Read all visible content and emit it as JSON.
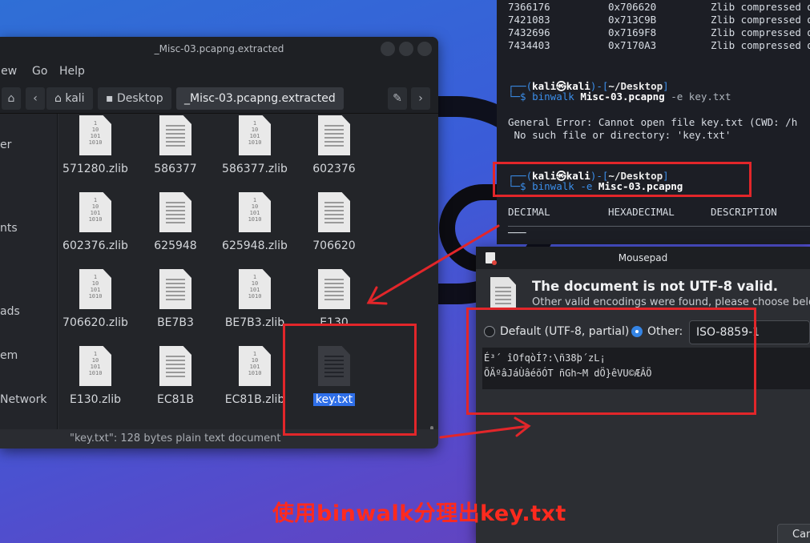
{
  "terminal": {
    "rows": [
      {
        "decimal": "7366176",
        "hex": "0x706620",
        "desc": "Zlib compressed data"
      },
      {
        "decimal": "7421083",
        "hex": "0x713C9B",
        "desc": "Zlib compressed data"
      },
      {
        "decimal": "7432696",
        "hex": "0x7169F8",
        "desc": "Zlib compressed data"
      },
      {
        "decimal": "7434403",
        "hex": "0x7170A3",
        "desc": "Zlib compressed data"
      }
    ],
    "prompt1": {
      "open": "┌──(",
      "user": "kali㉿kali",
      "mid": ")-[",
      "path": "~/Desktop",
      "close": "]",
      "lead": "└─$ ",
      "cmd": "binwalk",
      "arg": "Misc-03.pcapng",
      "flags": "-e key.txt"
    },
    "error1": "General Error: Cannot open file key.txt (CWD: /h",
    "error2": " No such file or directory: 'key.txt'",
    "prompt2": {
      "open": "┌──(",
      "user": "kali㉿kali",
      "mid": ")-[",
      "path": "~/Desktop",
      "close": "]",
      "lead": "└─$ ",
      "cmd": "binwalk",
      "flag": "-e",
      "arg": "Misc-03.pcapng"
    },
    "headers": {
      "decimal": "DECIMAL",
      "hex": "HEXADECIMAL",
      "desc": "DESCRIPTION"
    },
    "dashes": "───"
  },
  "file_manager": {
    "title": "_Misc-03.pcapng.extracted",
    "menu": [
      "View",
      "Go",
      "Help"
    ],
    "breadcrumb": [
      "kali",
      "Desktop",
      "_Misc-03.pcapng.extracted"
    ],
    "sidebar": [
      "er",
      "nts",
      "ads",
      "em",
      "Network"
    ],
    "files": [
      {
        "name": "571280.zlib",
        "type": "binary"
      },
      {
        "name": "586377",
        "type": "text"
      },
      {
        "name": "586377.zlib",
        "type": "binary"
      },
      {
        "name": "602376",
        "type": "text"
      },
      {
        "name": "602376.zlib",
        "type": "binary"
      },
      {
        "name": "625948",
        "type": "text"
      },
      {
        "name": "625948.zlib",
        "type": "binary"
      },
      {
        "name": "706620",
        "type": "text"
      },
      {
        "name": "706620.zlib",
        "type": "binary"
      },
      {
        "name": "BE7B3",
        "type": "text"
      },
      {
        "name": "BE7B3.zlib",
        "type": "binary"
      },
      {
        "name": "E130",
        "type": "text"
      },
      {
        "name": "E130.zlib",
        "type": "binary"
      },
      {
        "name": "EC81B",
        "type": "text"
      },
      {
        "name": "EC81B.zlib",
        "type": "binary"
      },
      {
        "name": "key.txt",
        "type": "text-dark",
        "selected": true
      }
    ],
    "binary_glyph": "1\n10\n101\n1010",
    "status": "\"key.txt\": 128 bytes plain text document"
  },
  "mousepad": {
    "title": "Mousepad",
    "heading": "The document is not UTF-8 valid.",
    "subtext": "Other valid encodings were found, please choose belo",
    "radio_default": "Default (UTF-8, partial)",
    "radio_other": "Other:",
    "encoding_value": "ISO-8859-1",
    "preview_line1": "É³´ îOfqòÍ?:\\ñ38þ´zL¡",
    "preview_line2": "ÕÄºâJáÙâéõÓT ñGh~M dÖ}êVU©ÆÂÖ",
    "cancel_label": "Can"
  },
  "annotation": {
    "caption": "使用binwalk分理出key.txt",
    "color": "#e2262a"
  }
}
